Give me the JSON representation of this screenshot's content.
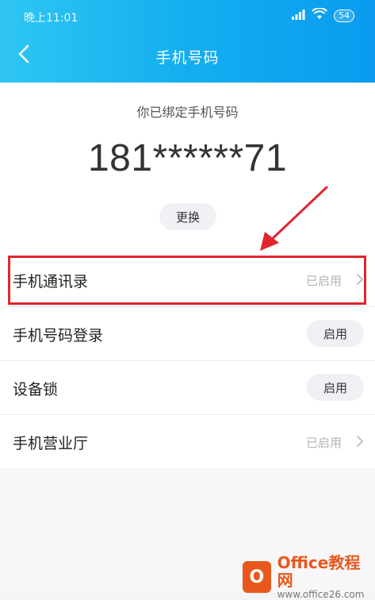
{
  "status_bar": {
    "time": "晚上11:01",
    "battery": "54"
  },
  "navbar": {
    "title": "手机号码"
  },
  "binding": {
    "label": "你已绑定手机号码",
    "phone": "181******71",
    "change_label": "更换"
  },
  "list": {
    "items": [
      {
        "label": "手机通讯录",
        "status": "已启用"
      },
      {
        "label": "手机号码登录",
        "action": "启用"
      },
      {
        "label": "设备锁",
        "action": "启用"
      },
      {
        "label": "手机营业厅",
        "status": "已启用"
      }
    ]
  },
  "annotation": {
    "color": "#e0252f"
  },
  "watermark": {
    "title": "Office教程网",
    "url": "www.office26.com"
  },
  "colors": {
    "header_start": "#2fc6f2",
    "header_end": "#0a9bee",
    "accent_red": "#e0252f"
  }
}
